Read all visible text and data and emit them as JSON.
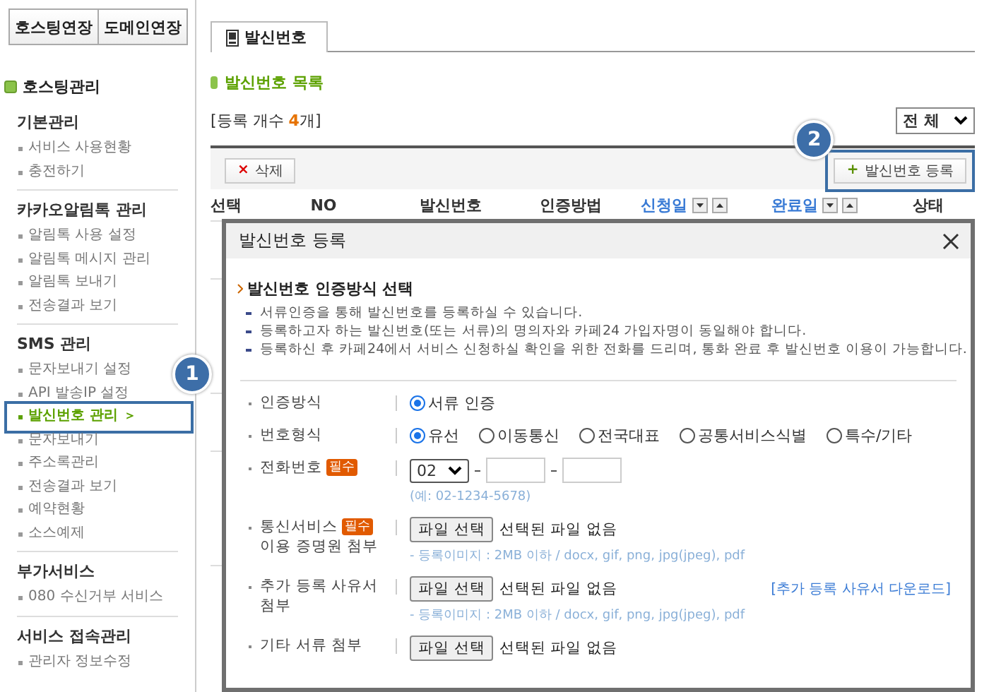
{
  "top_buttons": [
    {
      "label": "호스팅연장"
    },
    {
      "label": "도메인연장"
    }
  ],
  "sidebar": {
    "title": "호스팅관리",
    "groups": [
      {
        "heading": "기본관리",
        "items": [
          {
            "label": "서비스 사용현황",
            "selected": false
          },
          {
            "label": "충전하기",
            "selected": false
          }
        ]
      },
      {
        "heading": "카카오알림톡 관리",
        "items": [
          {
            "label": "알림톡 사용 설정",
            "selected": false
          },
          {
            "label": "알림톡 메시지 관리",
            "selected": false
          },
          {
            "label": "알림톡 보내기",
            "selected": false
          },
          {
            "label": "전송결과 보기",
            "selected": false
          }
        ]
      },
      {
        "heading": "SMS 관리",
        "items": [
          {
            "label": "문자보내기 설정",
            "selected": false
          },
          {
            "label": "API 발송IP 설정",
            "selected": false
          },
          {
            "label": "발신번호 관리",
            "selected": true,
            "arrow": "＞",
            "callout": "1"
          },
          {
            "label": "문자보내기",
            "selected": false
          },
          {
            "label": "주소록관리",
            "selected": false
          },
          {
            "label": "전송결과 보기",
            "selected": false
          },
          {
            "label": "예약현황",
            "selected": false
          },
          {
            "label": "소스예제",
            "selected": false
          }
        ]
      },
      {
        "heading": "부가서비스",
        "items": [
          {
            "label": "080 수신거부 서비스",
            "selected": false
          }
        ]
      },
      {
        "heading": "서비스 접속관리",
        "items": [
          {
            "label": "관리자 정보수정",
            "selected": false
          }
        ]
      }
    ]
  },
  "tabs": [
    {
      "label": "발신번호",
      "selected": true
    }
  ],
  "section_title": "발신번호 목록",
  "count": "[등록 개수 **4**개]",
  "filter": {
    "value": "전 체"
  },
  "delete_button": {
    "icon": "×",
    "label": "삭제"
  },
  "register_button": {
    "icon": "+",
    "label": "발신번호 등록",
    "callout": "2"
  },
  "columns": [
    {
      "label": "선택",
      "sortable": false
    },
    {
      "label": "NO",
      "sortable": false
    },
    {
      "label": "발신번호",
      "sortable": false
    },
    {
      "label": "인증방법",
      "sortable": false
    },
    {
      "label": "신청일",
      "sortable": true
    },
    {
      "label": "완료일",
      "sortable": true
    },
    {
      "label": "상태",
      "sortable": false
    }
  ],
  "modal": {
    "title": "발신번호 등록",
    "heading": "발신번호 인증방식 선택",
    "notes": [
      "서류인증을 통해 발신번호를 등록하실 수 있습니다.",
      "등록하고자 하는 발신번호(또는 서류)의 명의자와 카페24 가입자명이 동일해야 합니다.",
      "등록하신 후 카페24에서 서비스 신청하실 확인을 위한 전화를 드리며, 통화 완료 후 발신번호 이용이 가능합니다."
    ],
    "fields": [
      {
        "kind": "radio",
        "label_lines": [
          "인증방식"
        ],
        "options": [
          {
            "label": "서류 인증",
            "selected": true
          }
        ]
      },
      {
        "kind": "radio",
        "label_lines": [
          "번호형식"
        ],
        "options": [
          {
            "label": "유선",
            "selected": true
          },
          {
            "label": "이동통신",
            "selected": false
          },
          {
            "label": "전국대표",
            "selected": false
          },
          {
            "label": "공통서비스식별",
            "selected": false
          },
          {
            "label": "특수/기타",
            "selected": false
          }
        ]
      },
      {
        "kind": "phone",
        "label_lines": [
          "전화번호"
        ],
        "required_label": "필수",
        "area_code": "02",
        "hint": "(예: 02-1234-5678)"
      },
      {
        "kind": "file",
        "label_lines": [
          "통신서비스",
          "이용 증명원 첨부"
        ],
        "required_label": "필수",
        "button": "파일 선택",
        "status": "선택된 파일 없음",
        "hint": "- 등록이미지 : 2MB 이하 / docx, gif, png, jpg(jpeg), pdf"
      },
      {
        "kind": "file",
        "label_lines": [
          "추가 등록 사유서",
          "첨부"
        ],
        "button": "파일 선택",
        "status": "선택된 파일 없음",
        "hint": "- 등록이미지 : 2MB 이하 / docx, gif, png, jpg(jpeg), pdf",
        "link": "[추가 등록 사유서 다운로드]"
      },
      {
        "kind": "file",
        "label_lines": [
          "기타 서류 첨부"
        ],
        "button": "파일 선택",
        "status": "선택된 파일 없음"
      }
    ]
  }
}
